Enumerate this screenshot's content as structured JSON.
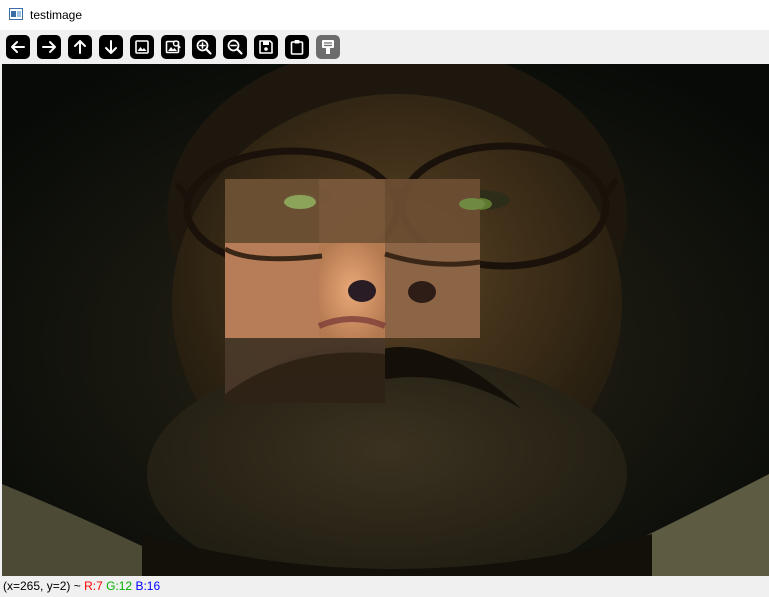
{
  "window": {
    "title": "testimage",
    "icon": "image-window-icon"
  },
  "toolbar": {
    "buttons": [
      {
        "icon": "arrow-left-icon",
        "enabled": true
      },
      {
        "icon": "arrow-right-icon",
        "enabled": true
      },
      {
        "icon": "arrow-up-icon",
        "enabled": true
      },
      {
        "icon": "arrow-down-icon",
        "enabled": true
      },
      {
        "icon": "zoom-fit-icon",
        "enabled": true
      },
      {
        "icon": "zoom-image-icon",
        "enabled": true
      },
      {
        "icon": "zoom-in-icon",
        "enabled": true
      },
      {
        "icon": "zoom-out-icon",
        "enabled": true
      },
      {
        "icon": "save-icon",
        "enabled": true
      },
      {
        "icon": "clipboard-icon",
        "enabled": true
      },
      {
        "icon": "properties-icon",
        "enabled": false
      }
    ]
  },
  "status": {
    "coords": "(x=265, y=2) ~",
    "r": "R:7",
    "g": "G:12",
    "b": "B:16"
  },
  "colors": {
    "title_bg": "#ffffff",
    "toolbar_bg": "#f0f0f0",
    "button_bg": "#000000",
    "button_disabled_bg": "#6d6d6d",
    "r_color": "#ff0000",
    "g_color": "#00b000",
    "b_color": "#0000ff"
  }
}
